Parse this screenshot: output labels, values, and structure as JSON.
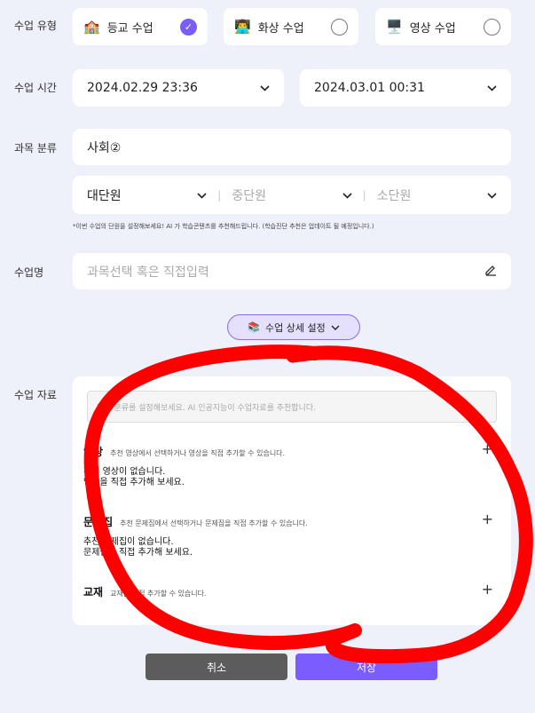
{
  "labels": {
    "class_type": "수업 유형",
    "class_time": "수업 시간",
    "subject": "과목 분류",
    "class_name": "수업명",
    "material": "수업 자료"
  },
  "class_types": [
    {
      "icon": "🏫",
      "label": "등교 수업",
      "checked": true
    },
    {
      "icon": "👨‍💻",
      "label": "화상 수업",
      "checked": false
    },
    {
      "icon": "🖥️",
      "label": "영상 수업",
      "checked": false
    }
  ],
  "time": {
    "start": "2024.02.29 23:36",
    "end": "2024.03.01 00:31"
  },
  "subject_value": "사회②",
  "units": {
    "large": "대단원",
    "medium": "중단원",
    "small": "소단원"
  },
  "unit_note": "*이번 수업의 단원을 설정해보세요! AI 가 학습콘텐츠를 추천해드립니다. (학습진단 추천은 업데이트 될 예정입니다.)",
  "class_name_placeholder": "과목선택 혹은 직접입력",
  "detail_button": {
    "icon": "📚",
    "label": "수업 상세 설정"
  },
  "material": {
    "ai_hint": "과목 분류를 설정해보세요. AI 인공지능이 수업자료를 추천합니다.",
    "sections": [
      {
        "title": "영상",
        "desc": "추천 영상에서 선택하거나 영상을 직접 추가할 수 있습니다.",
        "empty1": "추천 영상이 없습니다.",
        "empty2": "영상을 직접 추가해 보세요."
      },
      {
        "title": "문제집",
        "desc": "추천 문제집에서 선택하거나 문제집을 직접 추가할 수 있습니다.",
        "empty1": "추천 문제집이 없습니다.",
        "empty2": "문제집을 직접 추가해 보세요."
      },
      {
        "title": "교재",
        "desc": "교재를 직접 추가할 수 있습니다."
      }
    ]
  },
  "buttons": {
    "cancel": "취소",
    "save": "저장"
  },
  "colors": {
    "accent": "#7b5cff",
    "cancel": "#5c5c5c",
    "annotation": "#ff0000"
  }
}
